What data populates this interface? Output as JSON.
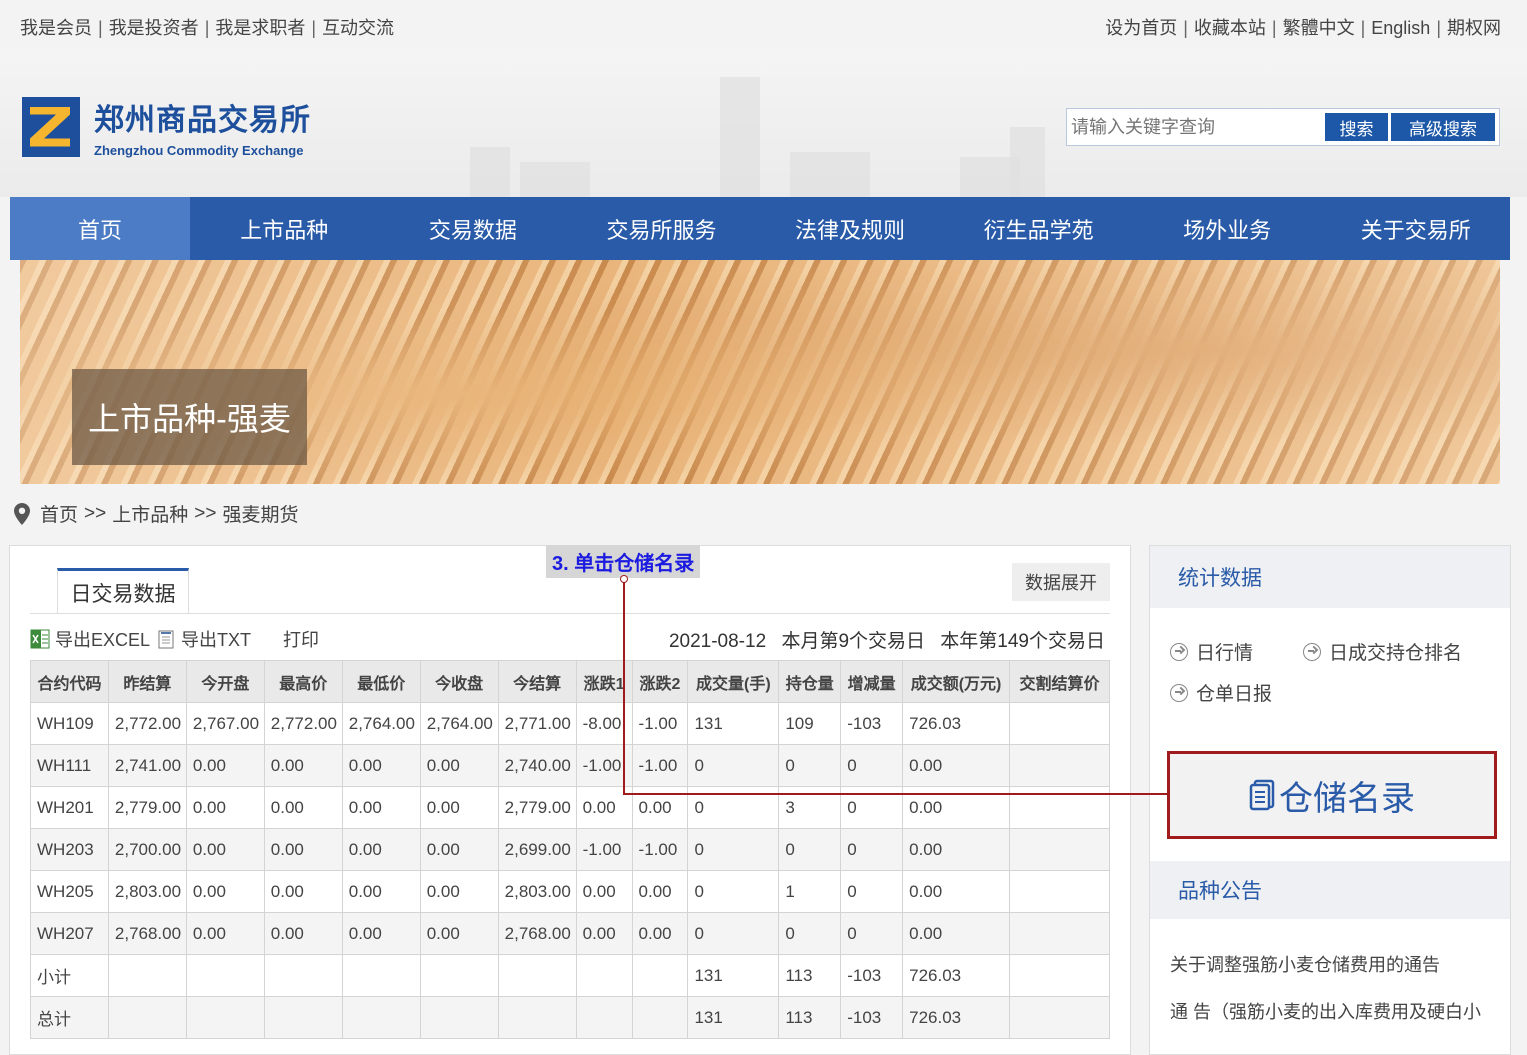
{
  "top_left_links": [
    "我是会员",
    "我是投资者",
    "我是求职者",
    "互动交流"
  ],
  "top_right_links": [
    "设为首页",
    "收藏本站",
    "繁體中文",
    "English",
    "期权网"
  ],
  "logo": {
    "cn": "郑州商品交易所",
    "en": "Zhengzhou Commodity Exchange"
  },
  "search": {
    "placeholder": "请输入关键字查询",
    "search_label": "搜索",
    "advanced_label": "高级搜索"
  },
  "nav": [
    "首页",
    "上市品种",
    "交易数据",
    "交易所服务",
    "法律及规则",
    "衍生品学苑",
    "场外业务",
    "关于交易所"
  ],
  "banner_label": "上市品种-强麦",
  "breadcrumb": {
    "home": "首页",
    "sep": ">>",
    "level1": "上市品种",
    "level2": "强麦期货"
  },
  "tab": "日交易数据",
  "expand_label": "数据展开",
  "toolbar": {
    "excel": "导出EXCEL",
    "txt": "导出TXT",
    "print": "打印"
  },
  "date_info": {
    "date": "2021-08-12",
    "month": "本月第9个交易日",
    "year": "本年第149个交易日"
  },
  "table": {
    "headers": [
      "合约代码",
      "昨结算",
      "今开盘",
      "最高价",
      "最低价",
      "今收盘",
      "今结算",
      "涨跌1",
      "涨跌2",
      "成交量(手)",
      "持仓量",
      "增减量",
      "成交额(万元)",
      "交割结算价"
    ],
    "rows": [
      [
        "WH109",
        "2,772.00",
        "2,767.00",
        "2,772.00",
        "2,764.00",
        "2,764.00",
        "2,771.00",
        "-8.00",
        "-1.00",
        "131",
        "109",
        "-103",
        "726.03",
        ""
      ],
      [
        "WH111",
        "2,741.00",
        "0.00",
        "0.00",
        "0.00",
        "0.00",
        "2,740.00",
        "-1.00",
        "-1.00",
        "0",
        "0",
        "0",
        "0.00",
        ""
      ],
      [
        "WH201",
        "2,779.00",
        "0.00",
        "0.00",
        "0.00",
        "0.00",
        "2,779.00",
        "0.00",
        "0.00",
        "0",
        "3",
        "0",
        "0.00",
        ""
      ],
      [
        "WH203",
        "2,700.00",
        "0.00",
        "0.00",
        "0.00",
        "0.00",
        "2,699.00",
        "-1.00",
        "-1.00",
        "0",
        "0",
        "0",
        "0.00",
        ""
      ],
      [
        "WH205",
        "2,803.00",
        "0.00",
        "0.00",
        "0.00",
        "0.00",
        "2,803.00",
        "0.00",
        "0.00",
        "0",
        "1",
        "0",
        "0.00",
        ""
      ],
      [
        "WH207",
        "2,768.00",
        "0.00",
        "0.00",
        "0.00",
        "0.00",
        "2,768.00",
        "0.00",
        "0.00",
        "0",
        "0",
        "0",
        "0.00",
        ""
      ],
      [
        "小计",
        "",
        "",
        "",
        "",
        "",
        "",
        "",
        "",
        "131",
        "113",
        "-103",
        "726.03",
        ""
      ],
      [
        "总计",
        "",
        "",
        "",
        "",
        "",
        "",
        "",
        "",
        "131",
        "113",
        "-103",
        "726.03",
        ""
      ]
    ]
  },
  "annotation": "3. 单击仓储名录",
  "side": {
    "stats_title": "统计数据",
    "links": [
      "日行情",
      "日成交持仓排名",
      "仓单日报"
    ],
    "warehouse_label": "仓储名录",
    "notice_title": "品种公告",
    "notices": [
      "关于调整强筋小麦仓储费用的通告",
      "通 告（强筋小麦的出入库费用及硬白小"
    ]
  },
  "colors": {
    "nav_bg": "#2a5ba8",
    "accent_red": "#a01c1c",
    "annotation_text": "#1a1ae0"
  }
}
